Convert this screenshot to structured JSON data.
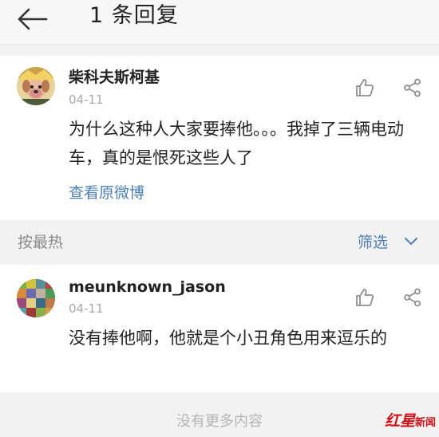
{
  "header": {
    "title": "1 条回复",
    "back_icon": "arrow-left-icon"
  },
  "main_comment": {
    "username": "柴科夫斯柯基",
    "date": "04-11",
    "text": "为什么这种人大家要捧他。。。我掉了三辆电动车，真的是恨死这些人了",
    "view_original": "查看原微博",
    "like_icon": "thumbs-up-icon",
    "share_icon": "share-icon"
  },
  "sort_bar": {
    "sort_label": "按最热",
    "filter_label": "筛选",
    "filter_icon": "chevron-down-icon"
  },
  "reply": {
    "username": "meunknown_jason",
    "date": "04-11",
    "text": "没有捧他啊，他就是个小丑角色用来逗乐的",
    "like_icon": "thumbs-up-icon",
    "share_icon": "share-icon"
  },
  "footer": {
    "no_more": "没有更多内容"
  },
  "watermark": {
    "text": "红星新闻"
  },
  "colors": {
    "link": "#4e7fb5",
    "text": "#222222",
    "muted": "#a8a8a8",
    "background": "#f2f2f2",
    "watermark": "#d0121b"
  }
}
